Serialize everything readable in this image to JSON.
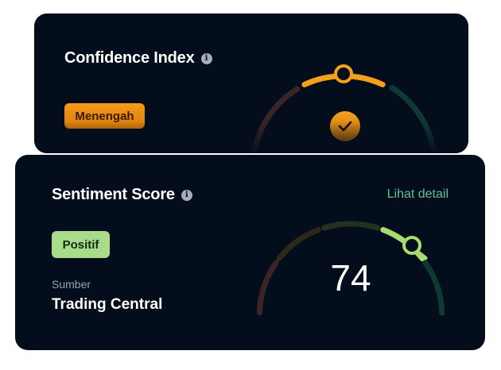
{
  "confidence": {
    "title": "Confidence Index",
    "info_icon": "info-icon",
    "badge": "Menengah",
    "status_icon": "check-icon",
    "colors": {
      "accent": "#f5a01c",
      "low": "#3a2426",
      "high": "#0f3a33"
    }
  },
  "sentiment": {
    "title": "Sentiment Score",
    "info_icon": "info-icon",
    "detail_link": "Lihat detail",
    "badge": "Positif",
    "source_label": "Sumber",
    "source_value": "Trading Central",
    "score": "74",
    "score_value": 74,
    "colors": {
      "accent": "#a8dc6e",
      "badge_bg": "#a8dc8a",
      "link": "#5cc48d"
    }
  }
}
